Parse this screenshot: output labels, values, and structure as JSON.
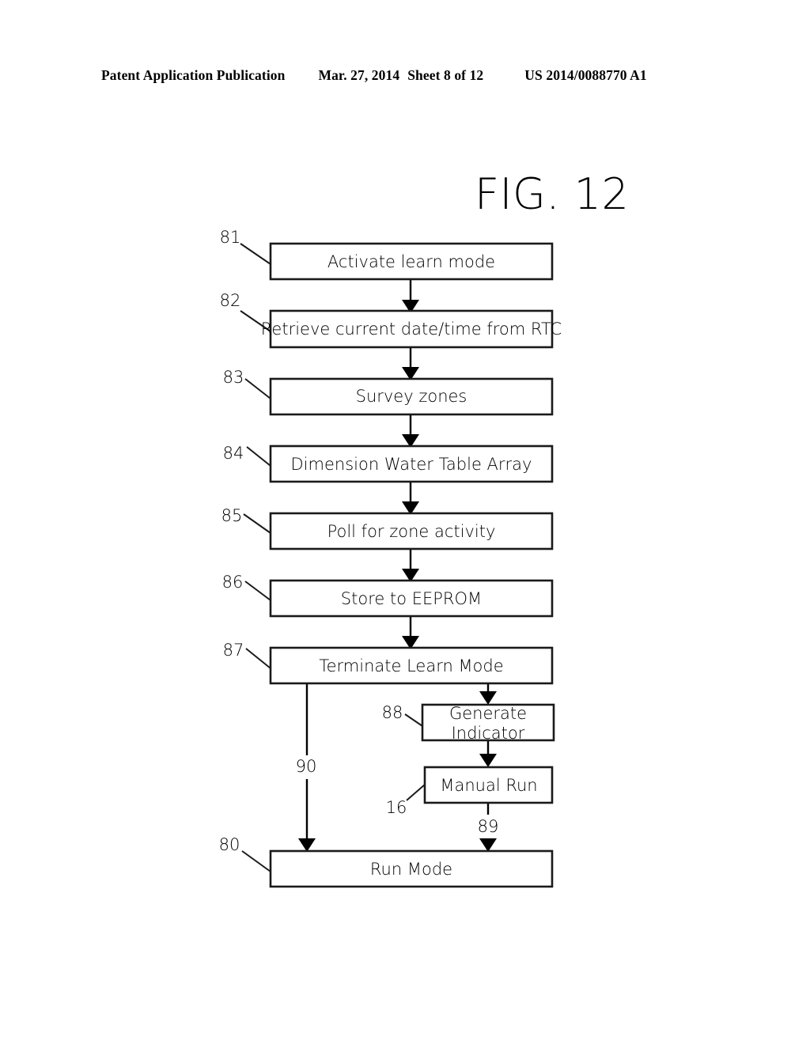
{
  "header": {
    "publication": "Patent Application Publication",
    "date": "Mar. 27, 2014",
    "sheet": "Sheet 8 of 12",
    "number": "US 2014/0088770 A1"
  },
  "figure": {
    "title": "FIG. 12"
  },
  "diagram": {
    "type": "flowchart",
    "nodes": [
      {
        "ref": "81",
        "label": "Activate learn mode"
      },
      {
        "ref": "82",
        "label": "Retrieve current date/time from RTC"
      },
      {
        "ref": "83",
        "label": "Survey zones"
      },
      {
        "ref": "84",
        "label": "Dimension Water Table Array"
      },
      {
        "ref": "85",
        "label": "Poll for zone activity"
      },
      {
        "ref": "86",
        "label": "Store to EEPROM"
      },
      {
        "ref": "87",
        "label": "Terminate Learn Mode"
      },
      {
        "ref": "88",
        "label_line1": "Generate",
        "label_line2": "Indicator"
      },
      {
        "ref": "16",
        "label": "Manual Run"
      },
      {
        "ref": "80",
        "label": "Run Mode"
      }
    ],
    "edge_labels": [
      {
        "ref": "90"
      },
      {
        "ref": "89"
      }
    ]
  }
}
